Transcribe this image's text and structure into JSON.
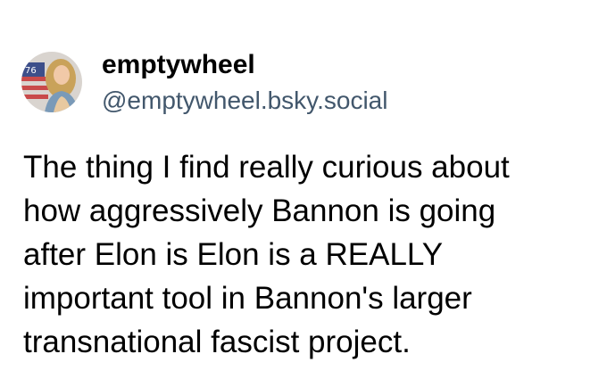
{
  "post": {
    "author": {
      "display_name": "emptywheel",
      "handle": "@emptywheel.bsky.social",
      "avatar_icon": "profile-photo"
    },
    "text_lines": [
      "The thing I find really curious about",
      "how aggressively Bannon is going",
      "after Elon is Elon is a REALLY",
      "important tool in Bannon's larger",
      "transnational fascist project."
    ]
  },
  "colors": {
    "background": "#ffffff",
    "text": "#000000",
    "handle": "#42576c"
  }
}
